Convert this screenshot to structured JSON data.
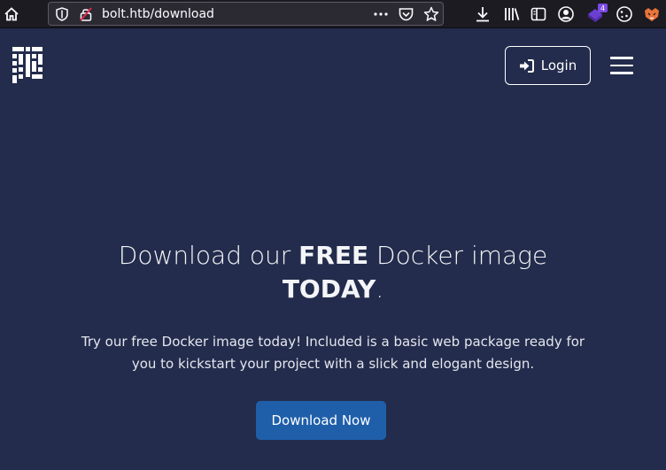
{
  "browser": {
    "url": "bolt.htb/download",
    "extension_badge": "4"
  },
  "header": {
    "login_label": "Login"
  },
  "hero": {
    "title_part1": "Download our ",
    "title_bold1": "FREE",
    "title_part2": " Docker image",
    "title_bold2": "TODAY",
    "title_part3": ".",
    "description": "Try our free Docker image today! Included is a basic web package ready for you to kickstart your project with a slick and elogant design.",
    "cta_label": "Download Now"
  },
  "colors": {
    "page_background": "#232c4c",
    "cta_background": "#1f5faa",
    "browser_chrome": "#1c1b22"
  }
}
